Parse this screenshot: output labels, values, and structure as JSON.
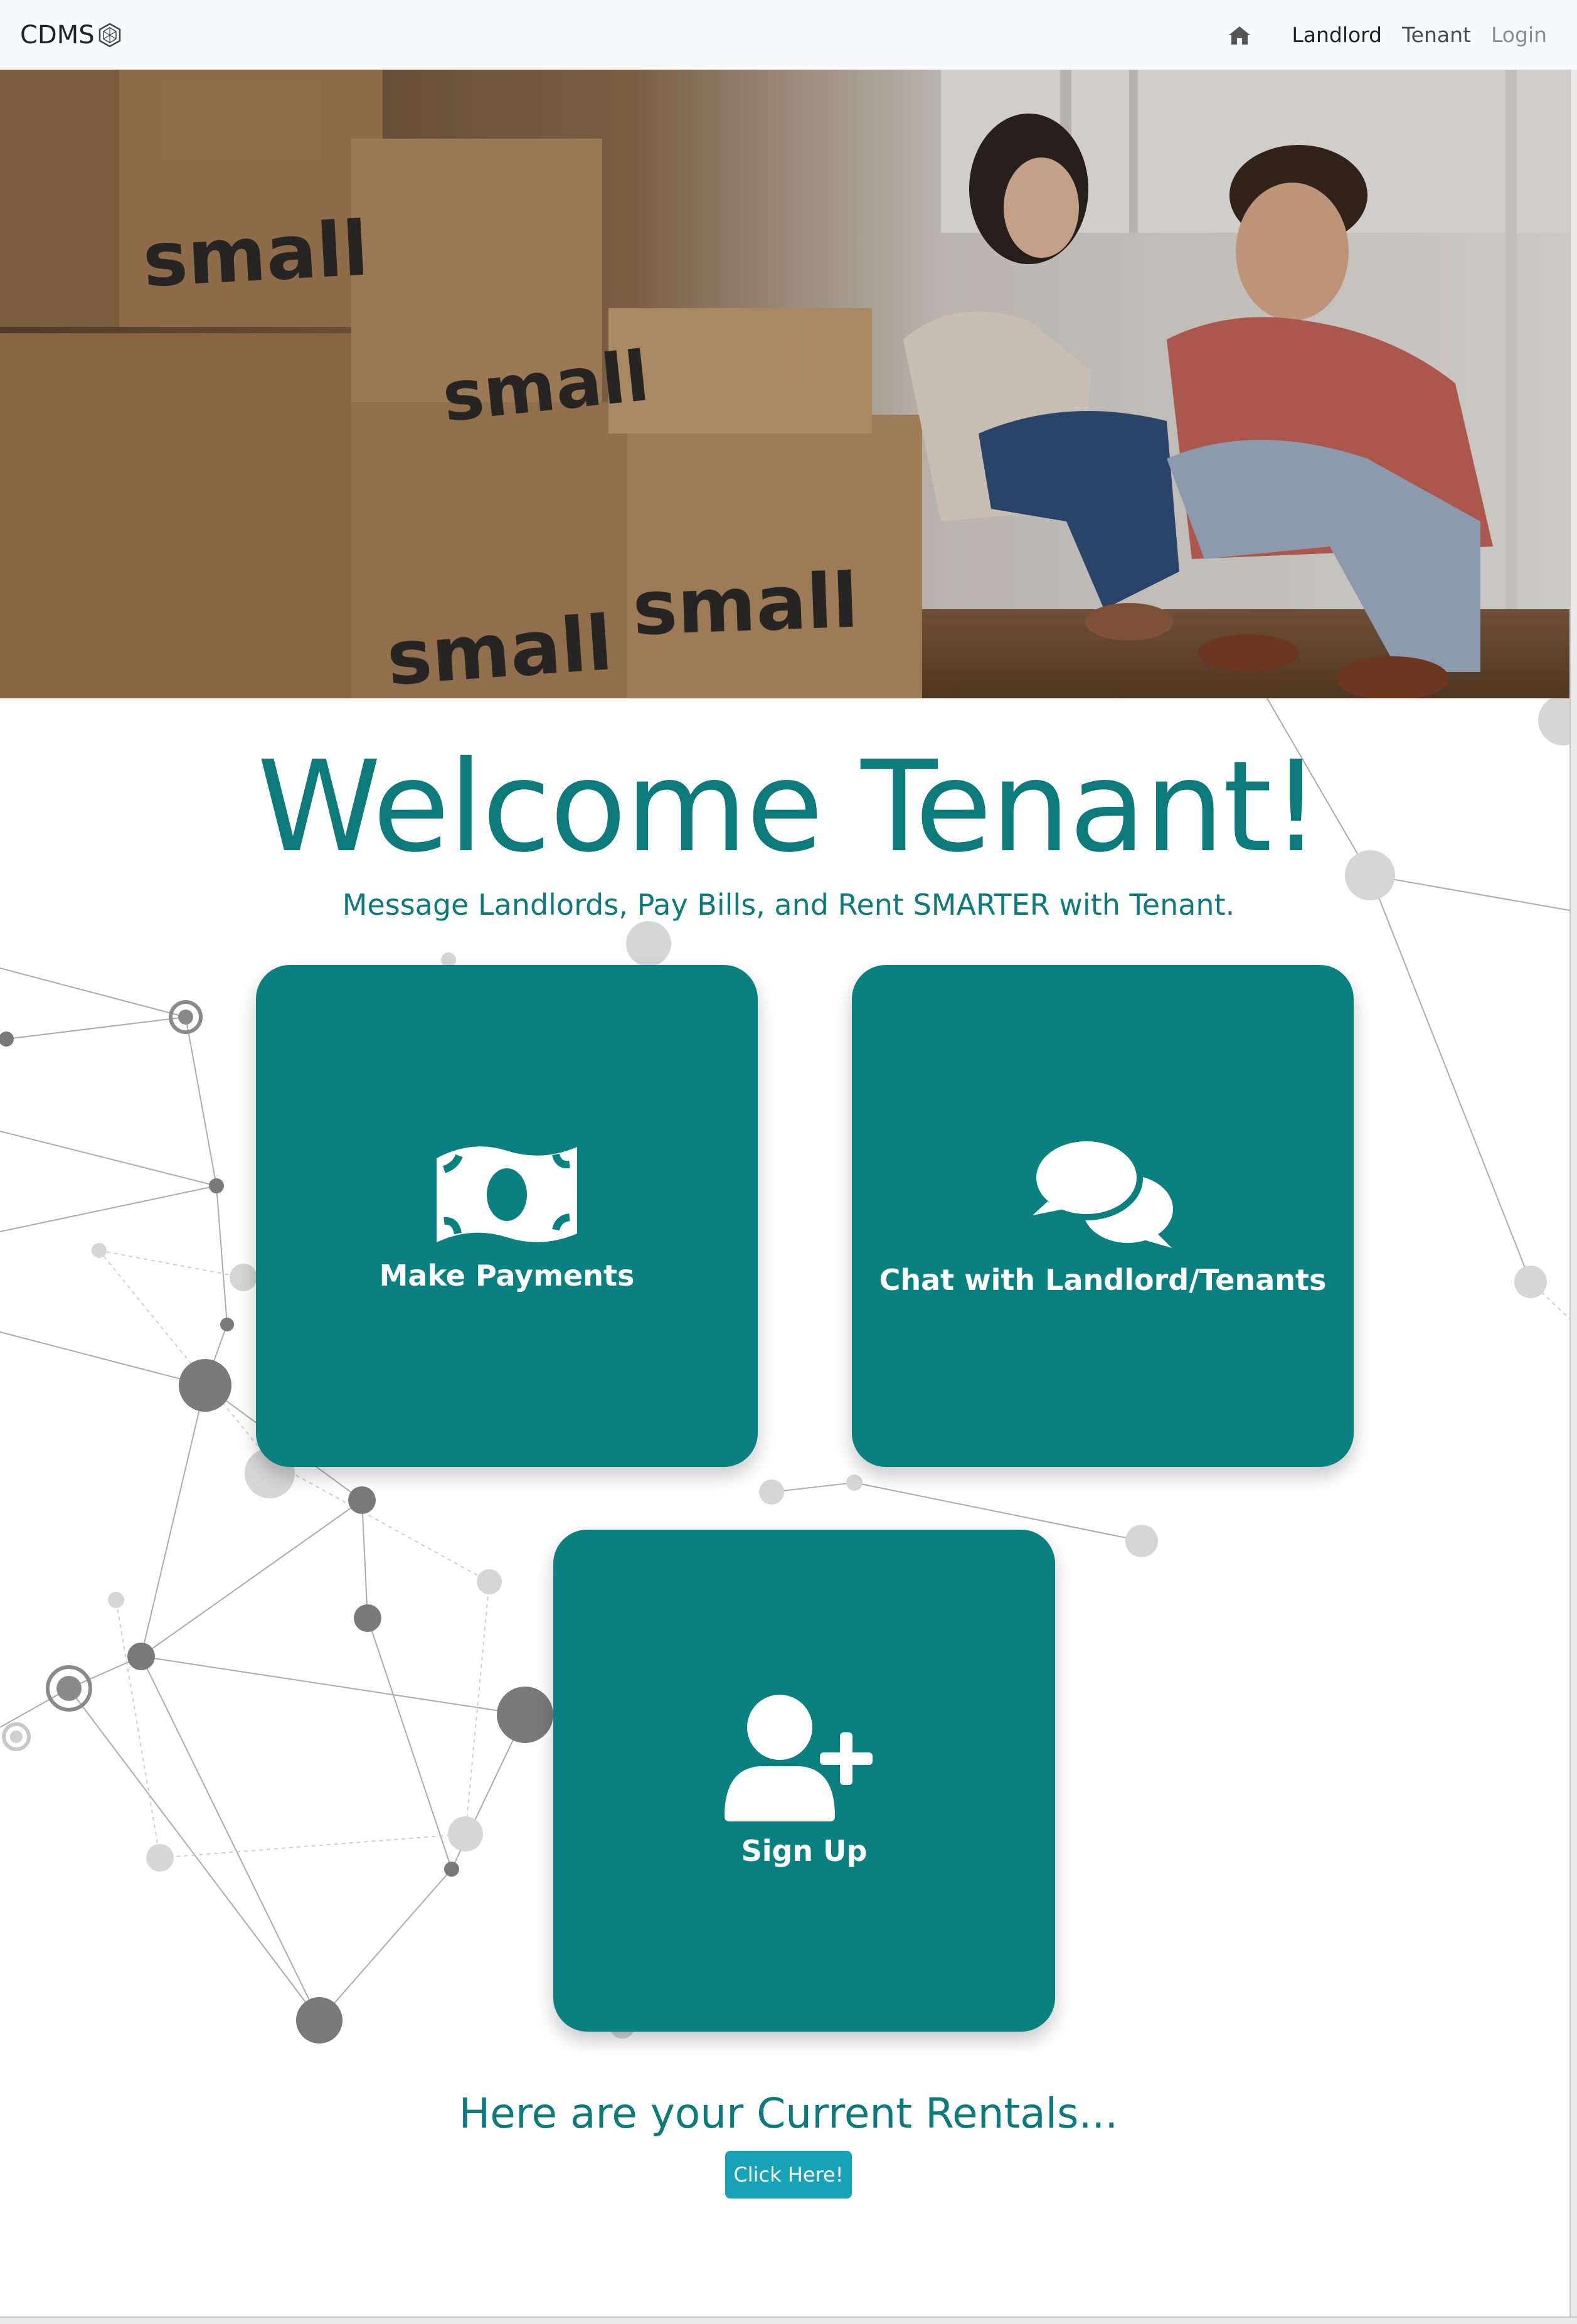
{
  "navbar": {
    "brand": "CDMS",
    "links": [
      {
        "label": "Landlord"
      },
      {
        "label": "Tenant"
      },
      {
        "label": "Login"
      }
    ]
  },
  "hero": {
    "box_labels": [
      "small",
      "small",
      "small",
      "small"
    ]
  },
  "welcome": {
    "title": "Welcome Tenant!",
    "subtitle": "Message Landlords, Pay Bills, and Rent SMARTER with Tenant."
  },
  "cards": {
    "payments": {
      "label": "Make Payments",
      "icon": "money-bill-icon"
    },
    "chat": {
      "label": "Chat with Landlord/Tenants",
      "icon": "comments-icon"
    },
    "signup": {
      "label": "Sign Up",
      "icon": "user-plus-icon"
    }
  },
  "rentals": {
    "heading": "Here are your Current Rentals...",
    "button_label": "Click Here!"
  },
  "colors": {
    "accent_teal": "#0a8080",
    "text_teal": "#0d7a7b",
    "button_info": "#17a2b8",
    "navbar_bg": "#f8f9fa"
  }
}
